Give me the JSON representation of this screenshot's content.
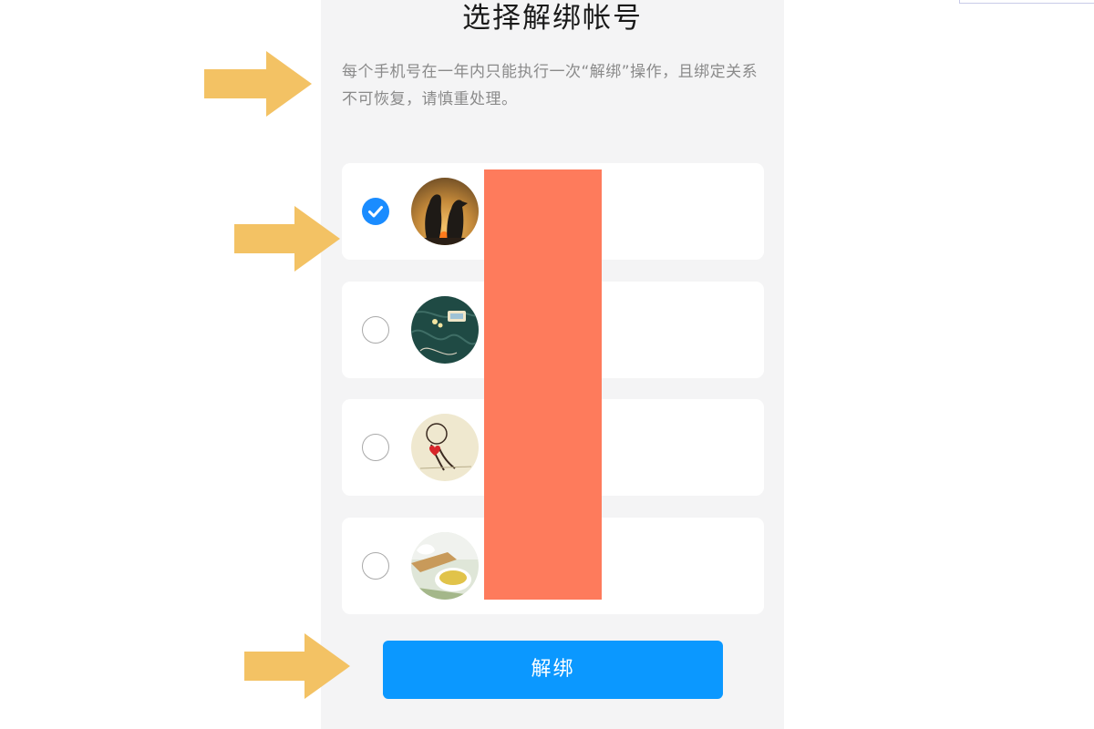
{
  "page": {
    "title": "选择解绑帐号",
    "description": "每个手机号在一年内只能执行一次“解绑”操作，且绑定关系不可恢复，请慎重处理。"
  },
  "accounts": [
    {
      "selected": true,
      "avatar": "penguins-sunset-avatar"
    },
    {
      "selected": false,
      "avatar": "dark-green-pattern-avatar"
    },
    {
      "selected": false,
      "avatar": "illustration-heart-avatar"
    },
    {
      "selected": false,
      "avatar": "tea-cup-avatar"
    }
  ],
  "actions": {
    "unbind_label": "解绑"
  },
  "colors": {
    "accent": "#0b98ff",
    "check": "#1a8cff",
    "annotation_arrow": "#f3c264",
    "redaction": "#fe7b5c",
    "panel_background": "#f4f4f5"
  }
}
